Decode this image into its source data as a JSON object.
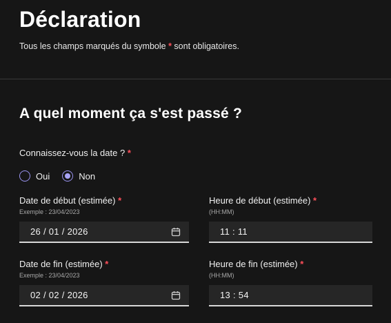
{
  "header": {
    "title": "Déclaration",
    "subtitle_before": "Tous les champs marqués du symbole ",
    "required_symbol": "*",
    "subtitle_after": " sont obligatoires."
  },
  "section": {
    "title": "A quel moment ça s'est passé ?"
  },
  "question": {
    "label": "Connaissez-vous la date ?",
    "options": [
      {
        "label": "Oui",
        "selected": false
      },
      {
        "label": "Non",
        "selected": true
      }
    ]
  },
  "fields": {
    "start_date": {
      "label": "Date de début (estimée)",
      "hint": "Exemple : 23/04/2023",
      "value": "26 / 01 / 2026"
    },
    "start_time": {
      "label": "Heure de début (estimée)",
      "hint": "(HH:MM)",
      "value": "11 : 11"
    },
    "end_date": {
      "label": "Date de fin (estimée)",
      "hint": "Exemple : 23/04/2023",
      "value": "02 / 02 / 2026"
    },
    "end_time": {
      "label": "Heure de fin (estimée)",
      "hint": "(HH:MM)",
      "value": "13 : 54"
    }
  },
  "icons": {
    "date_picker": "calendar-icon"
  },
  "colors": {
    "background": "#161616",
    "required": "#ff4f5a",
    "radio_accent": "#9a94f0",
    "input_bg": "#262626"
  }
}
